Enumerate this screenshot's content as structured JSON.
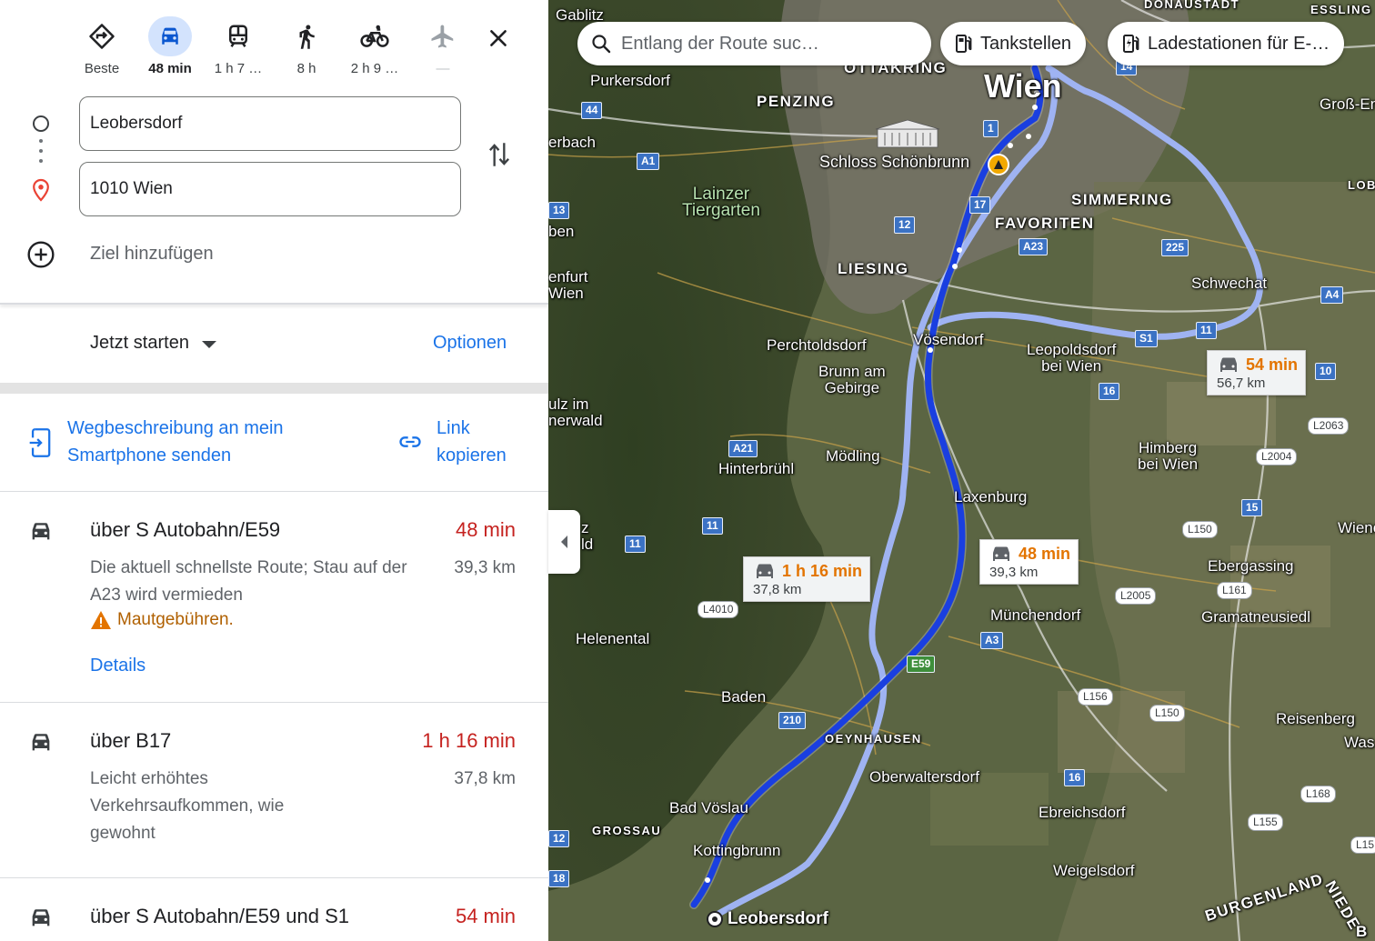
{
  "travel_modes": [
    {
      "icon": "directions-diamond-icon",
      "label": "Beste",
      "active": false
    },
    {
      "icon": "car-icon",
      "label": "48 min",
      "active": true
    },
    {
      "icon": "train-icon",
      "label": "1 h 7 …",
      "active": false
    },
    {
      "icon": "walk-icon",
      "label": "8 h",
      "active": false
    },
    {
      "icon": "bicycle-icon",
      "label": "2 h 9 …",
      "active": false
    },
    {
      "icon": "airplane-icon",
      "label": "—",
      "active": false
    }
  ],
  "origin": {
    "value": "Leobersdorf"
  },
  "destination": {
    "value": "1010 Wien"
  },
  "add_destination_label": "Ziel hinzufügen",
  "depart": {
    "label": "Jetzt starten",
    "options_label": "Optionen"
  },
  "share": {
    "send_label": "Wegbeschreibung an mein Smartphone senden",
    "link_label": "Link kopieren"
  },
  "routes": [
    {
      "name": "über S Autobahn/E59",
      "time": "48 min",
      "distance": "39,3 km",
      "description": "Die aktuell schnellste Route; Stau auf der A23 wird vermieden",
      "warning": "Mautgebühren.",
      "details_label": "Details"
    },
    {
      "name": "über B17",
      "time": "1 h 16 min",
      "distance": "37,8 km",
      "description": "Leicht erhöhtes Verkehrsaufkommen, wie gewohnt"
    },
    {
      "name": "über S Autobahn/E59 und S1",
      "time": "54 min"
    }
  ],
  "map": {
    "search_placeholder": "Entlang der Route suc…",
    "chips": [
      "Tankstellen",
      "Ladestationen für E-…"
    ],
    "callouts": [
      {
        "time": "48 min",
        "distance": "39,3 km"
      },
      {
        "time": "1 h 16 min",
        "distance": "37,8 km"
      },
      {
        "time": "54 min",
        "distance": "56,7 km"
      }
    ],
    "colors": {
      "primary_route": "#1a3fe0",
      "alt_route": "#9fb3f2",
      "time_orange": "#e37400",
      "time_red": "#c5221f",
      "link_blue": "#1a73e8"
    },
    "places": {
      "wien": "Wien",
      "ottakring": "OTTAKRING",
      "penzing": "PENZING",
      "purkersdorf": "Purkersdorf",
      "gablitz": "Gablitz",
      "donaustadt": "DONAUSTADT",
      "essling": "ESSLING",
      "gross_enz": "Groß-Enz",
      "lob": "LOB",
      "erbach": "erbach",
      "schoenbrunn": "Schloss Schönbrunn",
      "lainzer": "Lainzer\nTiergarten",
      "simmering": "SIMMERING",
      "favoriten": "FAVORITEN",
      "liesing": "LIESING",
      "schwechat": "Schwechat",
      "ben": "ben",
      "enfurt_wien": "enfurt\nWien",
      "perchtoldsdorf": "Perchtoldsdorf",
      "voesendorf": "Vösendorf",
      "leopoldsdorf": "Leopoldsdorf\nbei Wien",
      "brunn": "Brunn am\nGebirge",
      "ulz": "ulz im\nnerwald",
      "himberg": "Himberg\nbei Wien",
      "hinterbruehl": "Hinterbrühl",
      "moedling": "Mödling",
      "laxenburg": "Laxenburg",
      "wiene": "Wiene",
      "ebergassing": "Ebergassing",
      "z_ld": "z\nld",
      "helenental": "Helenental",
      "muenchendorf": "Münchendorf",
      "gramatneusiedl": "Gramatneusiedl",
      "baden": "Baden",
      "oeynhausen": "OEYNHAUSEN",
      "oberwaltersdorf": "Oberwaltersdorf",
      "reisenberg": "Reisenberg",
      "was": "Was",
      "bad_voeslau": "Bad Vöslau",
      "grossau": "GROSSAU",
      "ebreichsdorf": "Ebreichsdorf",
      "kottingbrunn": "Kottingbrunn",
      "weigelsdorf": "Weigelsdorf",
      "leobersdorf": "Leobersdorf",
      "burgenland": "BURGENLAND",
      "niede": "NIEDE",
      "b_edge": "B"
    },
    "road_shields": [
      "44",
      "A1",
      "1",
      "14",
      "17",
      "12",
      "A23",
      "225",
      "A4",
      "S1",
      "11",
      "10",
      "16",
      "A21",
      "11",
      "11",
      "E59",
      "A3",
      "210",
      "16",
      "12",
      "18",
      "13"
    ],
    "local_roads": [
      "L2063",
      "L2004",
      "L150",
      "L4010",
      "L2005",
      "L161",
      "L156",
      "L150",
      "L168",
      "L155",
      "L15",
      "15"
    ]
  }
}
